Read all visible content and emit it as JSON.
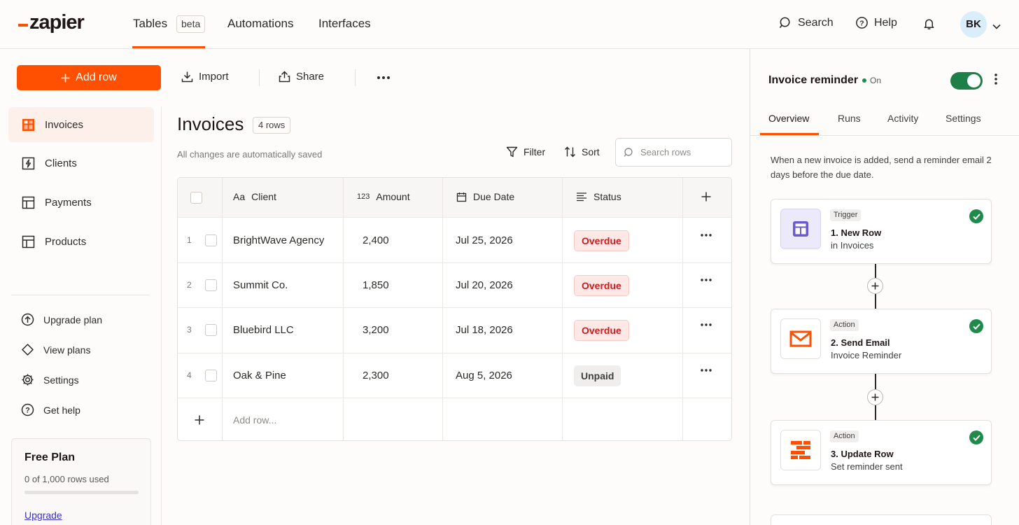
{
  "brand": {
    "logo_text": "zapier",
    "accent": "#ff4f00"
  },
  "topnav": {
    "tables_label": "Tables",
    "beta_badge": "beta",
    "automations_label": "Automations",
    "interfaces_label": "Interfaces",
    "search_label": "Search",
    "help_label": "Help",
    "avatar_initials": "BK"
  },
  "actionbar": {
    "add_row_label": "Add row",
    "import_label": "Import",
    "share_label": "Share"
  },
  "sidebar": {
    "tables": [
      {
        "label": "Invoices",
        "icon": "table-icon",
        "active": true
      },
      {
        "label": "Clients",
        "icon": "bolt-table-icon",
        "active": false
      },
      {
        "label": "Payments",
        "icon": "table-icon",
        "active": false
      },
      {
        "label": "Products",
        "icon": "table-icon",
        "active": false
      }
    ],
    "links": [
      {
        "label": "Upgrade plan",
        "icon": "arrow-up-circle-icon"
      },
      {
        "label": "View plans",
        "icon": "diamond-icon"
      },
      {
        "label": "Settings",
        "icon": "gear-icon"
      },
      {
        "label": "Get help",
        "icon": "help-circle-icon"
      }
    ],
    "plan": {
      "title": "Free Plan",
      "usage": "0 of 1,000 rows used",
      "usage_fraction": 0,
      "upgrade_label": "Upgrade"
    }
  },
  "table": {
    "title": "Invoices",
    "rows_badge": "4 rows",
    "autosave_note": "All changes are automatically saved",
    "filter_label": "Filter",
    "sort_label": "Sort",
    "search_placeholder": "Search rows",
    "columns": [
      {
        "label": "Client",
        "type_glyph": "Aa"
      },
      {
        "label": "Amount",
        "type_glyph": "123"
      },
      {
        "label": "Due Date",
        "type_glyph": "calendar-icon"
      },
      {
        "label": "Status",
        "type_glyph": "list-icon"
      }
    ],
    "rows": [
      {
        "num": "1",
        "client": "BrightWave Agency",
        "amount": "2,400",
        "due": "Jul 25, 2026",
        "status": "Overdue"
      },
      {
        "num": "2",
        "client": "Summit Co.",
        "amount": "1,850",
        "due": "Jul 20, 2026",
        "status": "Overdue"
      },
      {
        "num": "3",
        "client": "Bluebird LLC",
        "amount": "3,200",
        "due": "Jul 18, 2026",
        "status": "Overdue"
      },
      {
        "num": "4",
        "client": "Oak & Pine",
        "amount": "2,300",
        "due": "Aug 5, 2026",
        "status": "Unpaid"
      }
    ],
    "add_row_placeholder": "Add row..."
  },
  "zap_panel": {
    "title": "Invoice reminder",
    "status_label": "On",
    "enabled": true,
    "tabs": [
      "Overview",
      "Runs",
      "Activity",
      "Settings"
    ],
    "active_tab": "Overview",
    "description": "When a new invoice is added, send a reminder email 2 days before the due date.",
    "steps": [
      {
        "kind": "Trigger",
        "title": "1. New Row",
        "subtitle": "in Invoices",
        "app_icon": "tables-app-icon",
        "done": true
      },
      {
        "kind": "Action",
        "title": "2. Send Email",
        "subtitle": "Invoice Reminder",
        "app_icon": "email-app-icon",
        "done": true
      },
      {
        "kind": "Action",
        "title": "3. Update Row",
        "subtitle": "Set reminder sent",
        "app_icon": "zapier-tables-app-icon",
        "done": true
      }
    ]
  }
}
